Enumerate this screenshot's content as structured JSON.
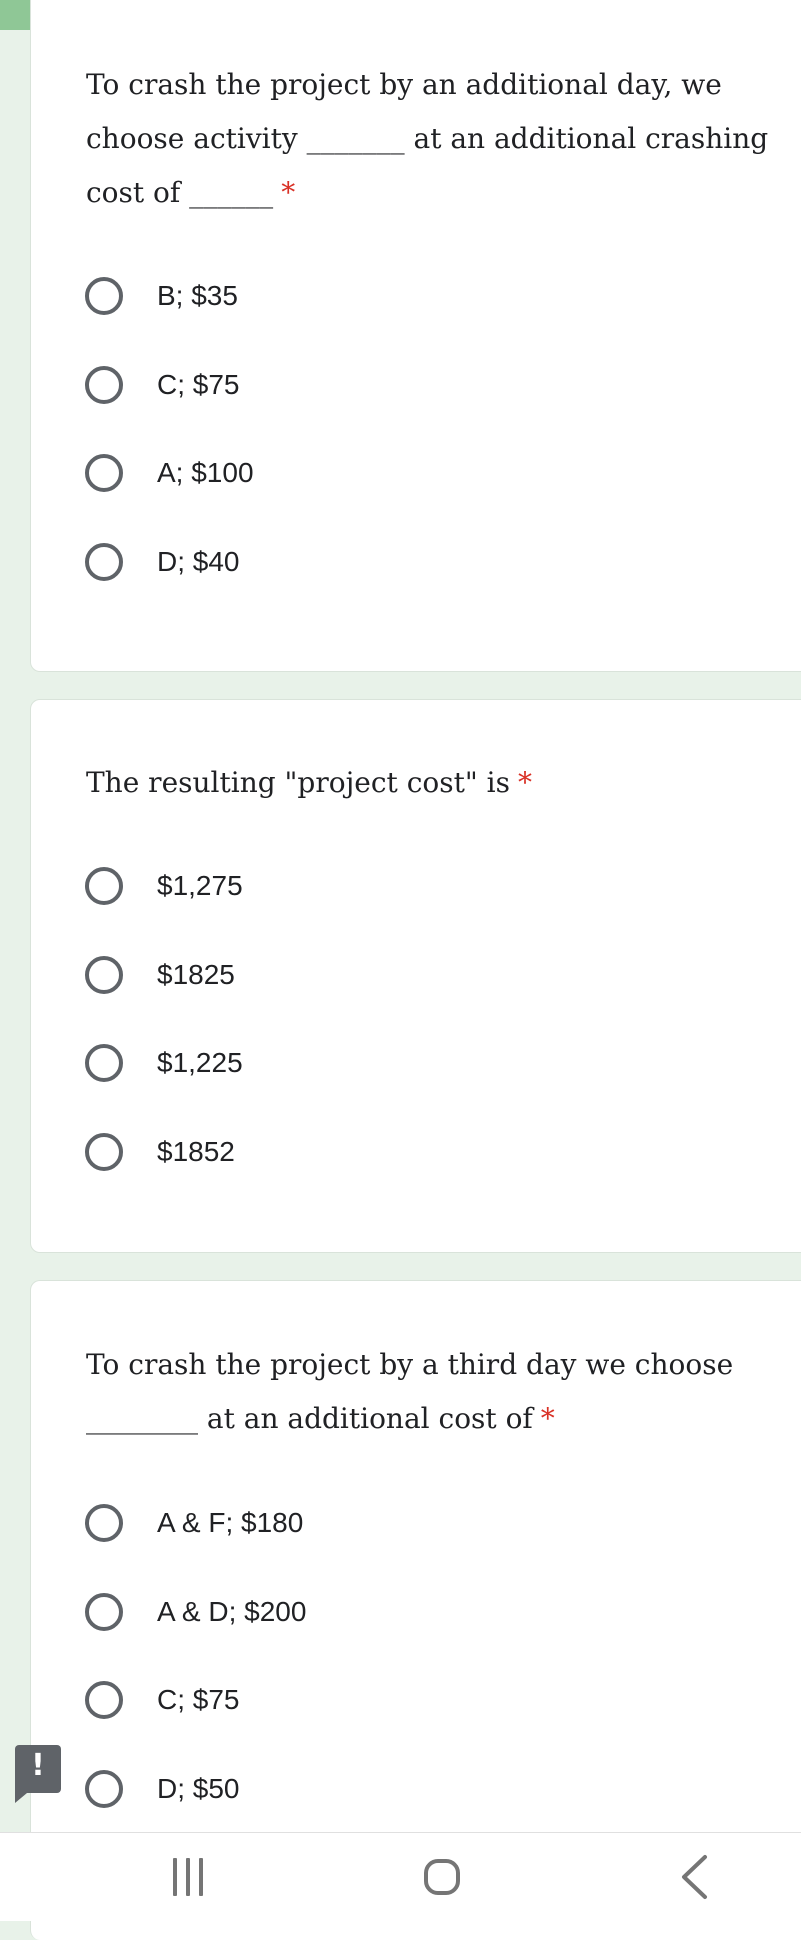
{
  "questions": [
    {
      "text": "To crash the project by an additional day, we choose activity _______ at an additional crashing cost of ______",
      "required_mark": "*",
      "options": [
        "B; $35",
        "C; $75",
        "A; $100",
        "D; $40"
      ]
    },
    {
      "text": "The resulting \"project cost\" is",
      "required_mark": "*",
      "options": [
        "$1,275",
        "$1825",
        "$1,225",
        "$1852"
      ]
    },
    {
      "text": "To crash the project by a third day we choose ________ at an additional cost of",
      "required_mark": "*",
      "options": [
        "A & F; $180",
        "A & D; $200",
        "C; $75",
        "D; $50"
      ]
    }
  ],
  "report_button": {
    "label": "!"
  },
  "colors": {
    "status_bar": "#8fc796",
    "page_background": "#e8f2e9",
    "required": "#d93025"
  },
  "nav": {
    "recents_icon": "recents-icon",
    "home_icon": "home-icon",
    "back_icon": "back-icon"
  }
}
